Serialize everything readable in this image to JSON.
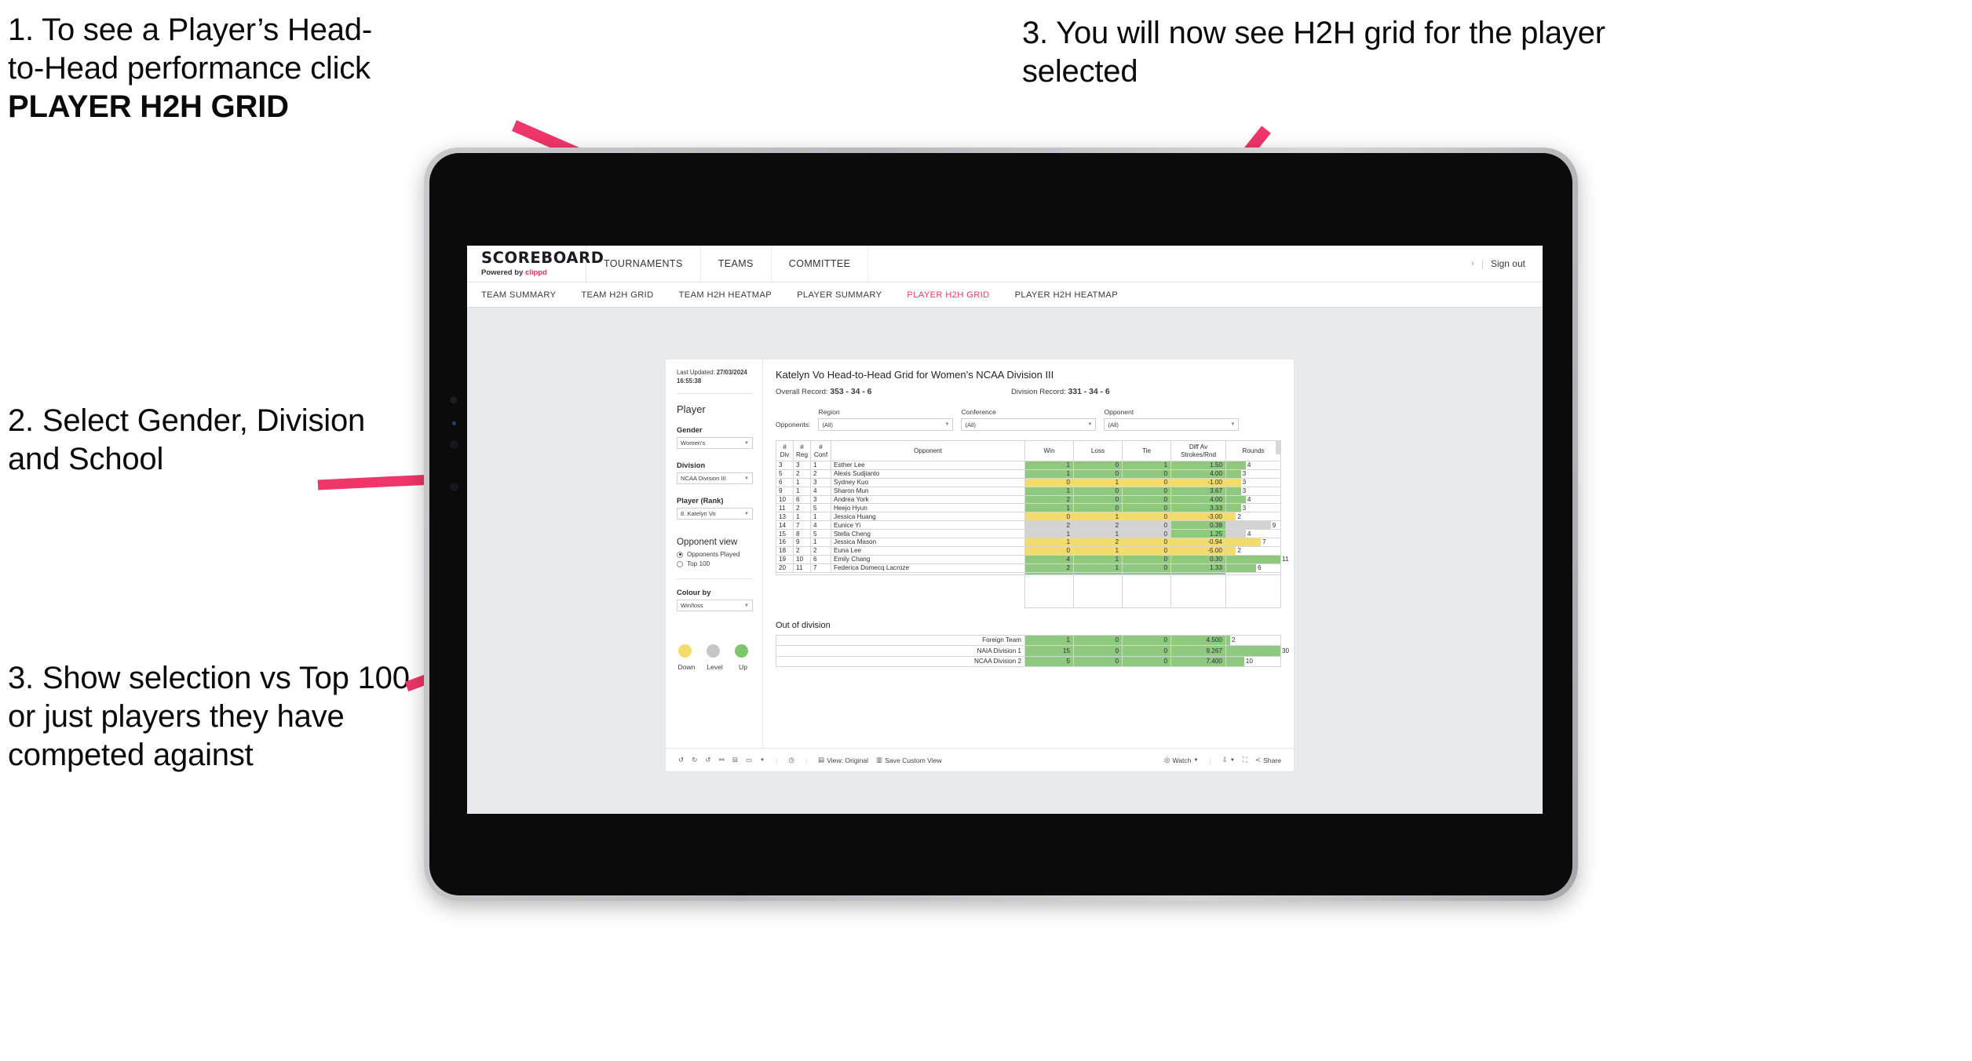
{
  "annotations": [
    {
      "id": "anno-1",
      "lines": [
        "1. To see a Player’s Head-",
        "to-Head performance click"
      ],
      "bold_line": "PLAYER H2H GRID"
    },
    {
      "id": "anno-2",
      "text": "2. Select Gender, Division and School"
    },
    {
      "id": "anno-3",
      "text": "3. Show selection vs Top 100 or just players they have competed against"
    },
    {
      "id": "anno-4",
      "text": "3. You will now see H2H grid for the player selected"
    }
  ],
  "arrow_color": "#ef3668",
  "app": {
    "brand": {
      "wordmark": "SCOREBOARD",
      "powered_prefix": "Powered by ",
      "powered_brand": "clippd"
    },
    "topnav": [
      "TOURNAMENTS",
      "TEAMS",
      "COMMITTEE"
    ],
    "signout": {
      "chevron": "›",
      "divider": "|",
      "label": "Sign out"
    },
    "tabs": [
      {
        "label": "TEAM SUMMARY",
        "active": false
      },
      {
        "label": "TEAM H2H GRID",
        "active": false
      },
      {
        "label": "TEAM H2H HEATMAP",
        "active": false
      },
      {
        "label": "PLAYER SUMMARY",
        "active": false
      },
      {
        "label": "PLAYER H2H GRID",
        "active": true
      },
      {
        "label": "PLAYER H2H HEATMAP",
        "active": false
      }
    ]
  },
  "sidebar": {
    "last_updated_label": "Last Updated: ",
    "last_updated_value": "27/03/2024 16:55:38",
    "section_player": "Player",
    "gender": {
      "label": "Gender",
      "value": "Women's"
    },
    "division": {
      "label": "Division",
      "value": "NCAA Division III"
    },
    "player_rank": {
      "label": "Player (Rank)",
      "value": "8. Katelyn Vo"
    },
    "opponent_view": {
      "title": "Opponent view",
      "options": [
        {
          "label": "Opponents Played",
          "selected": true
        },
        {
          "label": "Top 100",
          "selected": false
        }
      ]
    },
    "colour_by": {
      "label": "Colour by",
      "value": "Win/loss"
    },
    "legend": [
      {
        "label": "Down",
        "color": "#f4dc6b"
      },
      {
        "label": "Level",
        "color": "#c6c6c9"
      },
      {
        "label": "Up",
        "color": "#7ec66a"
      }
    ]
  },
  "viz": {
    "title": "Katelyn Vo Head-to-Head Grid for Women’s NCAA Division III",
    "overall_record_label": "Overall Record: ",
    "overall_record_value": "353 -  34 - 6",
    "division_record_label": "Division Record: ",
    "division_record_value": "331 -  34 - 6",
    "opponents_label": "Opponents:",
    "filters": [
      {
        "caption": "Region",
        "value": "(All)"
      },
      {
        "caption": "Conference",
        "value": "(All)"
      },
      {
        "caption": "Opponent",
        "value": "(All)"
      }
    ],
    "out_of_division_title": "Out of division"
  },
  "chart_data": {
    "type": "table",
    "title": "Katelyn Vo Head-to-Head Grid for Women’s NCAA Division III",
    "columns": [
      "# Div",
      "# Reg",
      "# Conf",
      "Opponent",
      "Win",
      "Loss",
      "Tie",
      "Diff Av Strokes/Rnd",
      "Rounds"
    ],
    "column_header_lines": [
      [
        "#",
        "Div"
      ],
      [
        "#",
        "Reg"
      ],
      [
        "#",
        "Conf"
      ],
      [
        "Opponent"
      ],
      [
        "Win"
      ],
      [
        "Loss"
      ],
      [
        "Tie"
      ],
      [
        "Diff Av",
        "Strokes/Rnd"
      ],
      [
        "Rounds"
      ]
    ],
    "rounds_max": 11,
    "rows": [
      {
        "div": "3",
        "reg": "3",
        "conf": "1",
        "opponent": "Esther Lee",
        "win": "1",
        "loss": "0",
        "tie": "1",
        "diff": "1.50",
        "rounds": 4,
        "state": "up"
      },
      {
        "div": "5",
        "reg": "2",
        "conf": "2",
        "opponent": "Alexis Sudjianto",
        "win": "1",
        "loss": "0",
        "tie": "0",
        "diff": "4.00",
        "rounds": 3,
        "state": "up"
      },
      {
        "div": "6",
        "reg": "1",
        "conf": "3",
        "opponent": "Sydney Kuo",
        "win": "0",
        "loss": "1",
        "tie": "0",
        "diff": "-1.00",
        "rounds": 3,
        "state": "down"
      },
      {
        "div": "9",
        "reg": "1",
        "conf": "4",
        "opponent": "Sharon Mun",
        "win": "1",
        "loss": "0",
        "tie": "0",
        "diff": "3.67",
        "rounds": 3,
        "state": "up"
      },
      {
        "div": "10",
        "reg": "6",
        "conf": "3",
        "opponent": "Andrea York",
        "win": "2",
        "loss": "0",
        "tie": "0",
        "diff": "4.00",
        "rounds": 4,
        "state": "up"
      },
      {
        "div": "11",
        "reg": "2",
        "conf": "5",
        "opponent": "Heejo Hyun",
        "win": "1",
        "loss": "0",
        "tie": "0",
        "diff": "3.33",
        "rounds": 3,
        "state": "up"
      },
      {
        "div": "13",
        "reg": "1",
        "conf": "1",
        "opponent": "Jessica Huang",
        "win": "0",
        "loss": "1",
        "tie": "0",
        "diff": "-3.00",
        "rounds": 2,
        "state": "down"
      },
      {
        "div": "14",
        "reg": "7",
        "conf": "4",
        "opponent": "Eunice Yi",
        "win": "2",
        "loss": "2",
        "tie": "0",
        "diff": "0.38",
        "rounds": 9,
        "state": "level",
        "diff_state": "up"
      },
      {
        "div": "15",
        "reg": "8",
        "conf": "5",
        "opponent": "Stella Cheng",
        "win": "1",
        "loss": "1",
        "tie": "0",
        "diff": "1.25",
        "rounds": 4,
        "state": "level",
        "diff_state": "up"
      },
      {
        "div": "16",
        "reg": "9",
        "conf": "1",
        "opponent": "Jessica Mason",
        "win": "1",
        "loss": "2",
        "tie": "0",
        "diff": "-0.94",
        "rounds": 7,
        "state": "down"
      },
      {
        "div": "18",
        "reg": "2",
        "conf": "2",
        "opponent": "Euna Lee",
        "win": "0",
        "loss": "1",
        "tie": "0",
        "diff": "-5.00",
        "rounds": 2,
        "state": "down"
      },
      {
        "div": "19",
        "reg": "10",
        "conf": "6",
        "opponent": "Emily Chang",
        "win": "4",
        "loss": "1",
        "tie": "0",
        "diff": "0.30",
        "rounds": 11,
        "state": "up"
      },
      {
        "div": "20",
        "reg": "11",
        "conf": "7",
        "opponent": "Federica Domecq Lacroze",
        "win": "2",
        "loss": "1",
        "tie": "0",
        "diff": "1.33",
        "rounds": 6,
        "state": "up"
      }
    ],
    "out_of_division": {
      "rounds_max": 30,
      "rows": [
        {
          "label": "Foreign Team",
          "win": "1",
          "loss": "0",
          "tie": "0",
          "diff": "4.500",
          "rounds": 2,
          "state": "up"
        },
        {
          "label": "NAIA Division 1",
          "win": "15",
          "loss": "0",
          "tie": "0",
          "diff": "9.267",
          "rounds": 30,
          "state": "up"
        },
        {
          "label": "NCAA Division 2",
          "win": "5",
          "loss": "0",
          "tie": "0",
          "diff": "7.400",
          "rounds": 10,
          "state": "up"
        }
      ]
    }
  },
  "toolbar": {
    "view_original": "View: Original",
    "save_custom_view": "Save Custom View",
    "watch": "Watch",
    "share": "Share"
  }
}
